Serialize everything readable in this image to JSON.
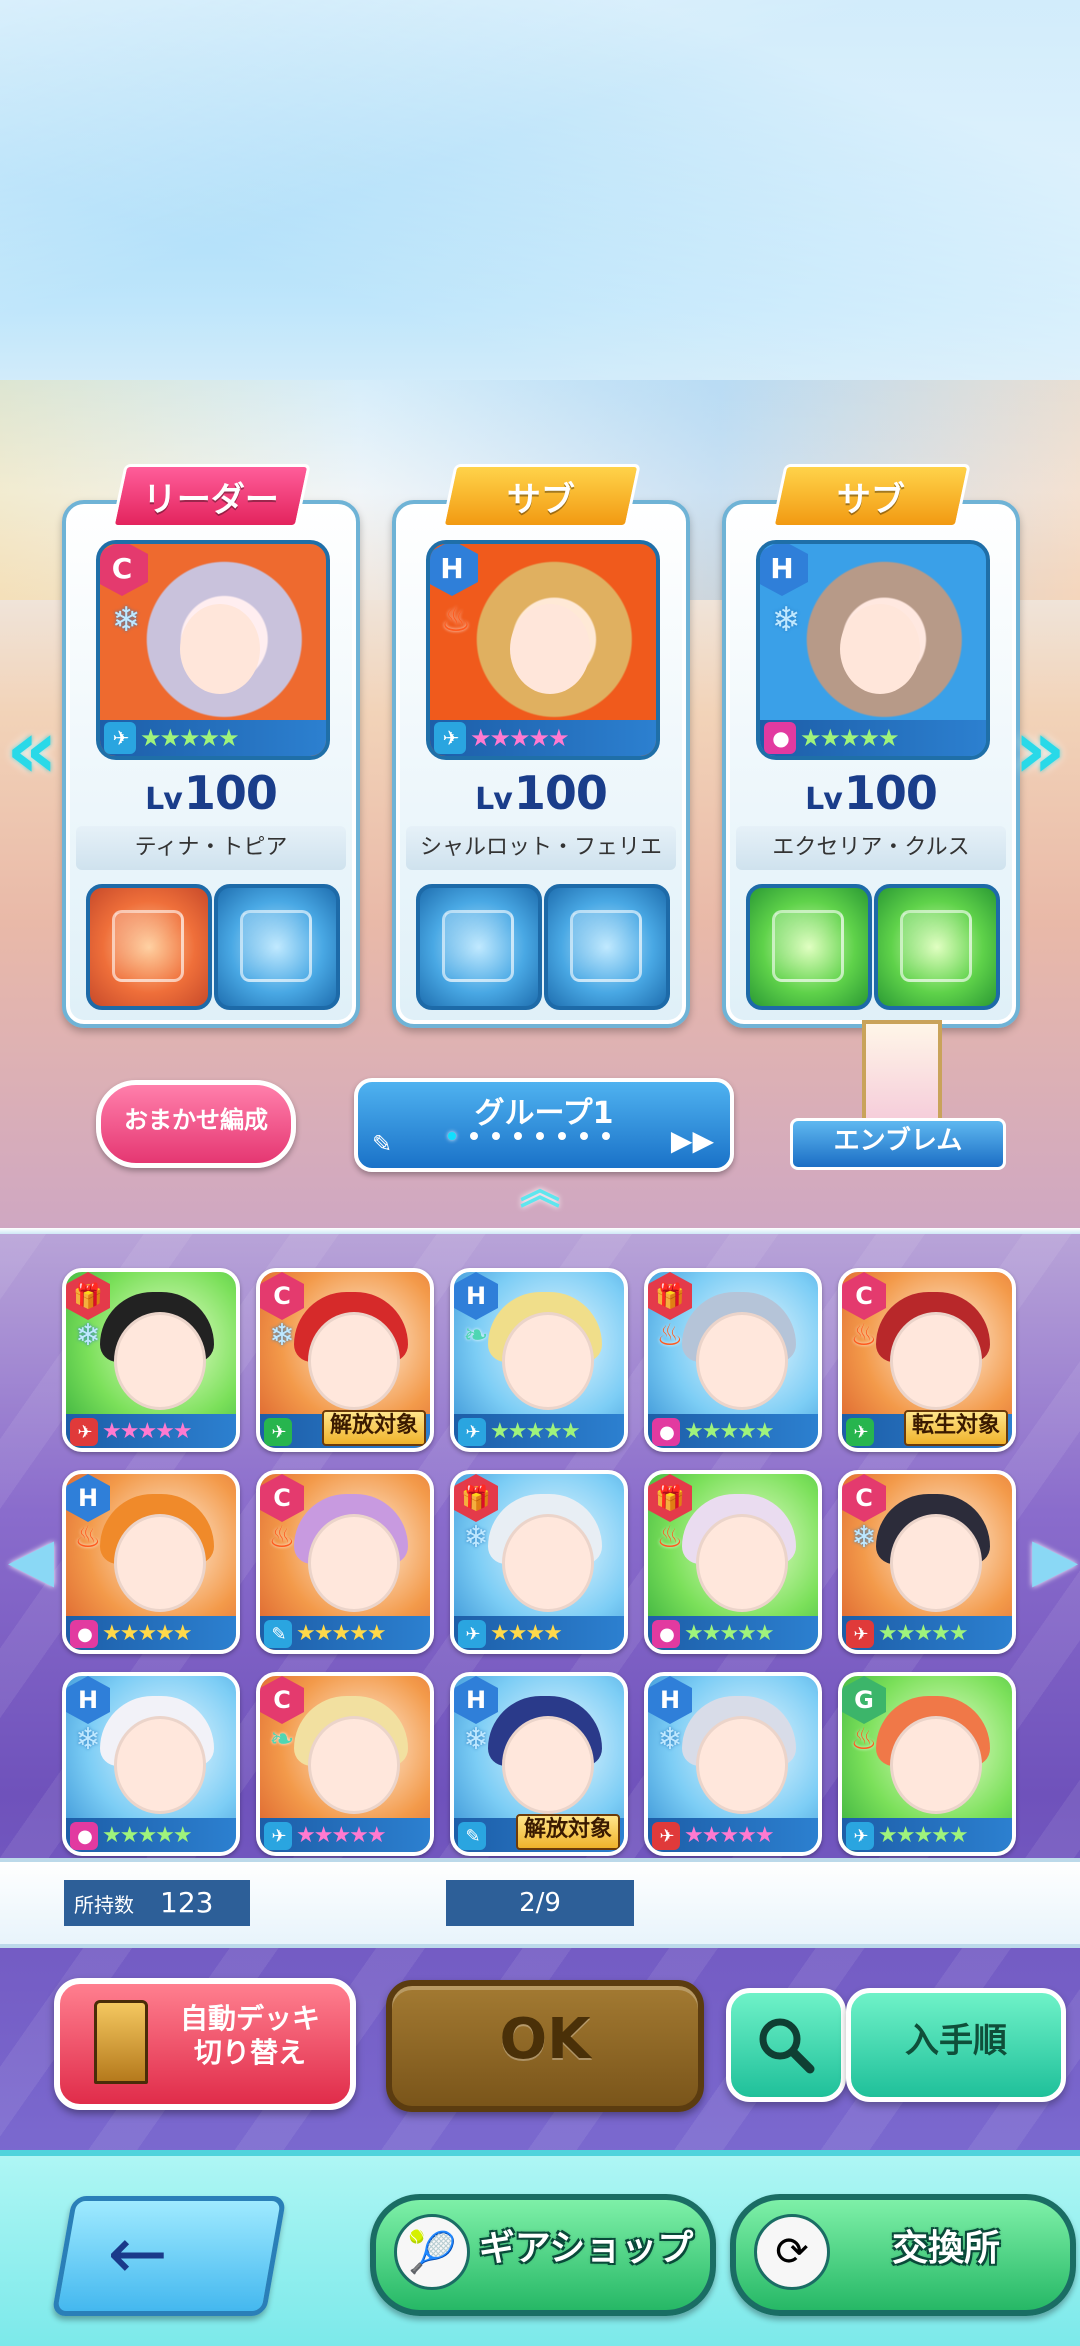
{
  "team": {
    "members": [
      {
        "role": "リーダー",
        "rarity": "C",
        "element": "ice",
        "level_prefix": "Lv",
        "level": "100",
        "name": "ティナ・トピア",
        "stars": "★★★★★"
      },
      {
        "role": "サブ",
        "rarity": "H",
        "element": "fire",
        "level_prefix": "Lv",
        "level": "100",
        "name": "シャルロット・フェリエ",
        "stars": "★★★★★"
      },
      {
        "role": "サブ",
        "rarity": "H",
        "element": "ice",
        "level_prefix": "Lv",
        "level": "100",
        "name": "エクセリア・クルス",
        "stars": "★★★★★"
      }
    ]
  },
  "controls": {
    "omakase": "おまかせ編成",
    "group_title": "グループ1",
    "emblem": "エンブレム"
  },
  "units": [
    {
      "badge": "gift",
      "element": "ice",
      "stars": "★★★★★",
      "tag": ""
    },
    {
      "badge": "C",
      "element": "ice",
      "stars": "",
      "tag": "解放対象"
    },
    {
      "badge": "H",
      "element": "wind",
      "stars": "★★★★★",
      "tag": ""
    },
    {
      "badge": "gift",
      "element": "fire",
      "stars": "★★★★★",
      "tag": ""
    },
    {
      "badge": "C",
      "element": "fire",
      "stars": "",
      "tag": "転生対象"
    },
    {
      "badge": "H",
      "element": "fire",
      "stars": "★★★★★",
      "tag": ""
    },
    {
      "badge": "C",
      "element": "fire",
      "stars": "★★★★★",
      "tag": ""
    },
    {
      "badge": "gift",
      "element": "ice",
      "stars": "★★★★",
      "tag": ""
    },
    {
      "badge": "gift",
      "element": "fire",
      "stars": "★★★★★",
      "tag": ""
    },
    {
      "badge": "C",
      "element": "ice",
      "stars": "★★★★★",
      "tag": ""
    },
    {
      "badge": "H",
      "element": "ice",
      "stars": "★★★★★",
      "tag": ""
    },
    {
      "badge": "C",
      "element": "wind",
      "stars": "★★★★★",
      "tag": ""
    },
    {
      "badge": "H",
      "element": "ice",
      "stars": "",
      "tag": "解放対象"
    },
    {
      "badge": "H",
      "element": "ice",
      "stars": "★★★★★",
      "tag": ""
    },
    {
      "badge": "G",
      "element": "fire",
      "stars": "★★★★★",
      "tag": ""
    }
  ],
  "inventory": {
    "count_label": "所持数",
    "count_value": "123",
    "page": "2/9"
  },
  "actions": {
    "auto_deck_line1": "自動デッキ",
    "auto_deck_line2": "切り替え",
    "ok": "OK",
    "sort": "入手順"
  },
  "bottom_nav": {
    "back_icon": "←",
    "gear_shop": "ギアショップ",
    "exchange": "交換所"
  },
  "icons": {
    "ice": "❄",
    "fire": "🔥",
    "wind": "❧",
    "gift": "🎁"
  },
  "colors": {
    "leader_tag": "#e3245d",
    "sub_tag": "#f29a12",
    "ok_button": "#7a551a",
    "teal_button": "#1fc09a"
  }
}
